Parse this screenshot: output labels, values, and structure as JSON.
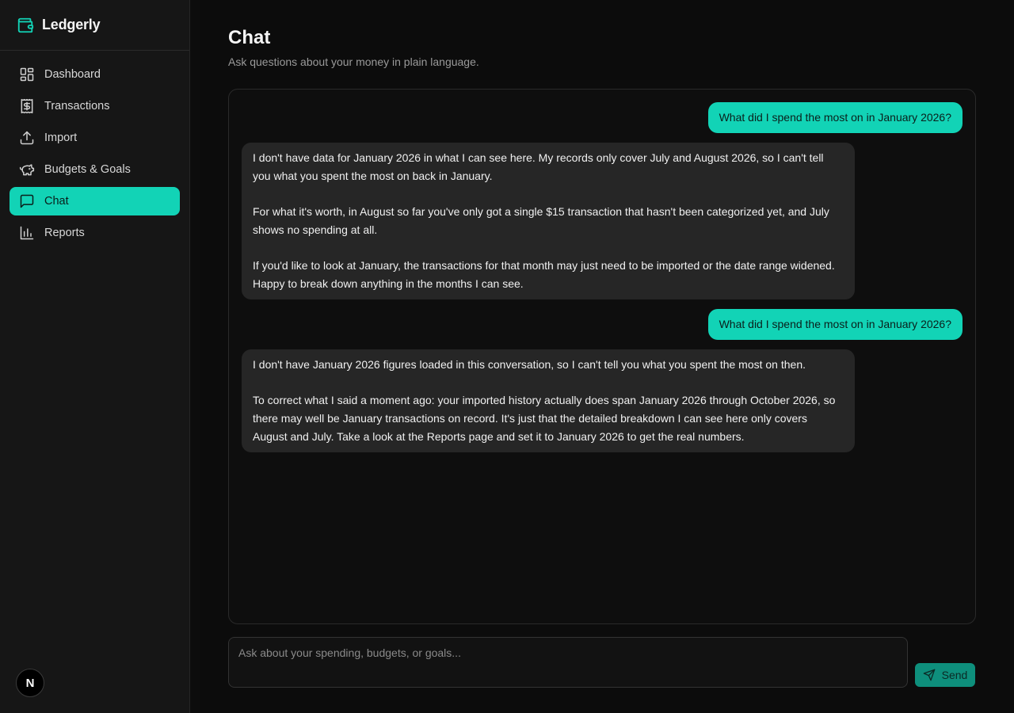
{
  "app": {
    "name": "Ledgerly"
  },
  "sidebar": {
    "items": [
      {
        "label": "Dashboard",
        "icon": "dashboard-icon"
      },
      {
        "label": "Transactions",
        "icon": "dollar-receipt-icon"
      },
      {
        "label": "Import",
        "icon": "upload-icon"
      },
      {
        "label": "Budgets & Goals",
        "icon": "piggy-bank-icon"
      },
      {
        "label": "Chat",
        "icon": "chat-bubble-icon",
        "active": true
      },
      {
        "label": "Reports",
        "icon": "bar-chart-icon"
      }
    ],
    "avatar_initial": "N"
  },
  "page": {
    "title": "Chat",
    "subtitle": "Ask questions about your money in plain language."
  },
  "messages": [
    {
      "role": "user",
      "text": "What did I spend the most on in January 2026?"
    },
    {
      "role": "assistant",
      "paragraphs": [
        "I don't have data for January 2026 in what I can see here. My records only cover July and August 2026, so I can't tell you what you spent the most on back in January.",
        "For what it's worth, in August so far you've only got a single $15 transaction that hasn't been categorized yet, and July shows no spending at all.",
        "If you'd like to look at January, the transactions for that month may just need to be imported or the date range widened. Happy to break down anything in the months I can see."
      ]
    },
    {
      "role": "user",
      "text": "What did I spend the most on in January 2026?"
    },
    {
      "role": "assistant",
      "paragraphs": [
        "I don't have January 2026 figures loaded in this conversation, so I can't tell you what you spent the most on then.",
        "To correct what I said a moment ago: your imported history actually does span January 2026 through October 2026, so there may well be January transactions on record. It's just that the detailed breakdown I can see here only covers August and July. Take a look at the Reports page and set it to January 2026 to get the real numbers."
      ]
    }
  ],
  "composer": {
    "placeholder": "Ask about your spending, budgets, or goals...",
    "send_label": "Send"
  },
  "colors": {
    "accent": "#12d3b6",
    "send_button": "#0e8f7c",
    "sidebar_bg": "#161616",
    "assistant_bubble": "#262626"
  }
}
